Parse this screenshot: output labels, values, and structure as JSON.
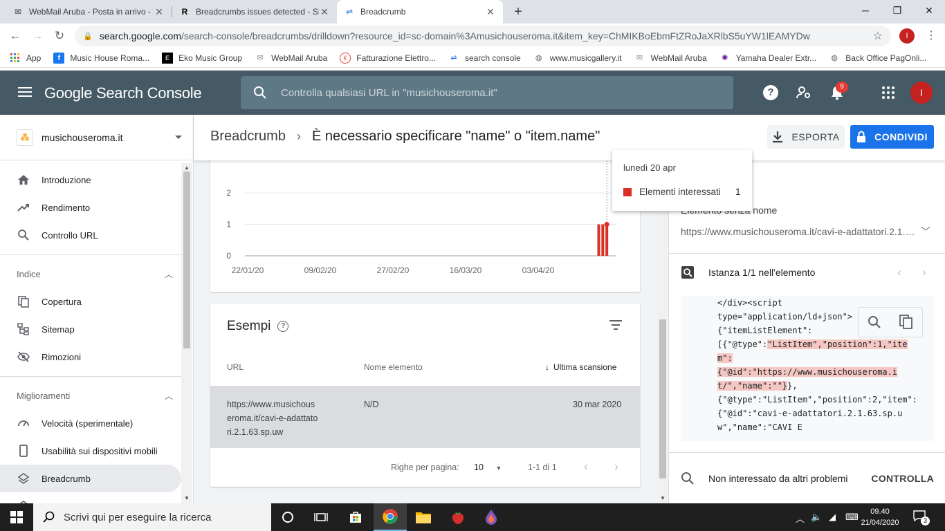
{
  "browser": {
    "tabs": [
      {
        "title": "WebMail Aruba - Posta in arrivo -",
        "favicon": "aruba-icon"
      },
      {
        "title": "Breadcrumbs issues detected - SE",
        "favicon": "r-icon"
      },
      {
        "title": "Breadcrumb",
        "favicon": "search-console-icon",
        "active": true
      }
    ],
    "url_prefix": "search.google.com",
    "url_rest": "/search-console/breadcrumbs/drilldown?resource_id=sc-domain%3Amusichouseroma.it&item_key=ChMIKBoEbmFtZRoJaXRlbS5uYW1lEAMYDw",
    "profile_initial": "I",
    "bookmarks": [
      {
        "label": "App",
        "icon": "apps-grid-icon"
      },
      {
        "label": "Music House Roma...",
        "icon": "facebook-icon"
      },
      {
        "label": "Eko Music Group",
        "icon": "eko-icon"
      },
      {
        "label": "WebMail Aruba",
        "icon": "aruba-icon"
      },
      {
        "label": "Fatturazione Elettro...",
        "icon": "invoice-icon"
      },
      {
        "label": "search console",
        "icon": "search-console-icon"
      },
      {
        "label": "www.musicgallery.it",
        "icon": "globe-icon"
      },
      {
        "label": "WebMail Aruba",
        "icon": "aruba-icon"
      },
      {
        "label": "Yamaha Dealer Extr...",
        "icon": "yamaha-icon"
      },
      {
        "label": "Back Office PagOnli...",
        "icon": "globe-icon"
      }
    ]
  },
  "header": {
    "logo_text": "Google Search Console",
    "search_placeholder": "Controlla qualsiasi URL in \"musichouseroma.it\"",
    "notification_count": "9",
    "avatar_initial": "I"
  },
  "sidebar": {
    "property": "musichouseroma.it",
    "top_items": [
      {
        "label": "Introduzione",
        "icon": "home-icon"
      },
      {
        "label": "Rendimento",
        "icon": "trending-icon"
      },
      {
        "label": "Controllo URL",
        "icon": "search-icon"
      }
    ],
    "sections": [
      {
        "title": "Indice",
        "items": [
          {
            "label": "Copertura",
            "icon": "copy-icon"
          },
          {
            "label": "Sitemap",
            "icon": "sitemap-icon"
          },
          {
            "label": "Rimozioni",
            "icon": "eye-off-icon"
          }
        ]
      },
      {
        "title": "Miglioramenti",
        "items": [
          {
            "label": "Velocità (sperimentale)",
            "icon": "speed-icon"
          },
          {
            "label": "Usabilità sui dispositivi mobili",
            "icon": "mobile-icon"
          },
          {
            "label": "Breadcrumb",
            "icon": "layers-icon",
            "active": true
          }
        ]
      }
    ]
  },
  "page": {
    "breadcrumb_root": "Breadcrumb",
    "breadcrumb_current": "È necessario specificare \"name\" o \"item.name\"",
    "export_label": "ESPORTA",
    "share_label": "CONDIVIDI"
  },
  "chart_data": {
    "type": "bar",
    "x_ticks": [
      "22/01/20",
      "09/02/20",
      "27/02/20",
      "16/03/20",
      "03/04/20"
    ],
    "y_ticks": [
      0,
      1,
      2
    ],
    "ylim": [
      0,
      2
    ],
    "series": [
      {
        "name": "Elementi interessati",
        "color": "#d93025",
        "points": [
          {
            "x": "18/04/20",
            "y": 1
          },
          {
            "x": "19/04/20",
            "y": 1
          },
          {
            "x": "20/04/20",
            "y": 1
          }
        ]
      }
    ],
    "tooltip": {
      "date": "lunedì 20 apr",
      "label": "Elementi interessati",
      "value": "1"
    }
  },
  "examples": {
    "title": "Esempi",
    "columns": [
      "URL",
      "Nome elemento",
      "Ultima scansione"
    ],
    "rows": [
      {
        "url_lines": [
          "https://www.musichous",
          "eroma.it/cavi-e-adattato",
          "ri.2.1.63.sp.uw"
        ],
        "name": "N/D",
        "date": "30 mar 2020"
      }
    ],
    "rows_per_page_label": "Righe per pagina:",
    "rows_per_page": "10",
    "range": "1-1 di 1"
  },
  "right_panel": {
    "element_label": "Elemento senza nome",
    "element_url": "https://www.musichouseroma.it/cavi-e-adattatori.2.1.63.sp.uw",
    "instance_label": "Istanza 1/1 nell'elemento",
    "code_before": "</div><script\ntype=\"application/ld+json\">\n{\"itemListElement\":\n[{\"@type\":",
    "code_highlight": "\"ListItem\",\"position\":1,\"item\":\n{\"@id\":\"https://www.musichouseroma.it/\",\"name\":\"\"}",
    "code_after": "},\n{\"@type\":\"ListItem\",\"position\":2,\"item\":{\"@id\":\"cavi-e-adattatori.2.1.63.sp.uw\",\"name\":\"CAVI E",
    "other_issues_label": "Non interessato da altri problemi",
    "check_label": "CONTROLLA"
  },
  "taskbar": {
    "search_placeholder": "Scrivi qui per eseguire la ricerca",
    "time": "09.40",
    "date": "21/04/2020",
    "notifications": "3"
  }
}
